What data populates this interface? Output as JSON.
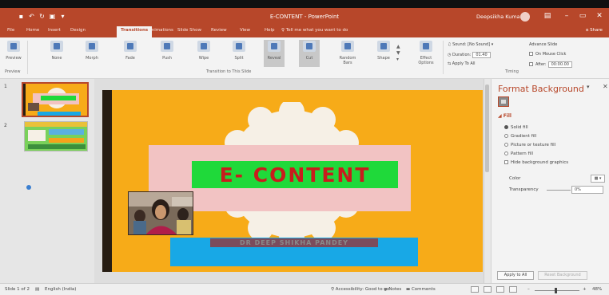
{
  "titlebar": {
    "doc_title": "E-CONTENT - PowerPoint",
    "user_name": "Deepsikha Kumari",
    "min": "–",
    "restore": "▭",
    "close": "✕",
    "bg": "#b7472a"
  },
  "tabs": [
    "File",
    "Home",
    "Insert",
    "Design",
    "Transitions",
    "Animations",
    "Slide Show",
    "Review",
    "View",
    "Help",
    "Tell me what you want to do"
  ],
  "share_label": "Share",
  "ribbon": {
    "preview_label": "Preview",
    "transitions": [
      "None",
      "Morph",
      "Fade",
      "Push",
      "Wipe",
      "Split",
      "Reveal",
      "Cut",
      "Random Bars",
      "Shape"
    ],
    "effect_options": "Effect Options",
    "sound": "Sound: [No Sound]",
    "duration": "Duration:",
    "duration_val": "01.40",
    "apply_all": "Apply To All",
    "advance_slide": "Advance Slide",
    "on_mouse_click": "On Mouse Click",
    "after": "After:",
    "after_val": "00:00.00",
    "group_preview": "Preview",
    "group_transitions": "Transition to This Slide",
    "group_timing": "Timing"
  },
  "thumbs": [
    {
      "num": "1"
    },
    {
      "num": "2"
    }
  ],
  "slide": {
    "title": "E- CONTENT",
    "author": "DR DEEP SHIKHA PANDEY",
    "bg": "#f7ab18",
    "title_box": "#1fd93a",
    "title_color": "#c81d1d",
    "band": "#f2c3c3",
    "blue": "#18a8e6"
  },
  "format_pane": {
    "title": "Format Background",
    "fill_head": "Fill",
    "options": [
      "Solid fill",
      "Gradient fill",
      "Picture or texture fill",
      "Pattern fill"
    ],
    "selected_option": "Solid fill",
    "hide_graphics": "Hide background graphics",
    "color_label": "Color",
    "transparency_label": "Transparency",
    "transparency_val": "0%",
    "apply_all": "Apply to All",
    "reset": "Reset Background"
  },
  "status": {
    "slide_of": "Slide 1 of 2",
    "language": "English (India)",
    "accessibility": "Accessibility: Good to go",
    "notes": "Notes",
    "comments": "Comments",
    "zoom": "48%"
  }
}
